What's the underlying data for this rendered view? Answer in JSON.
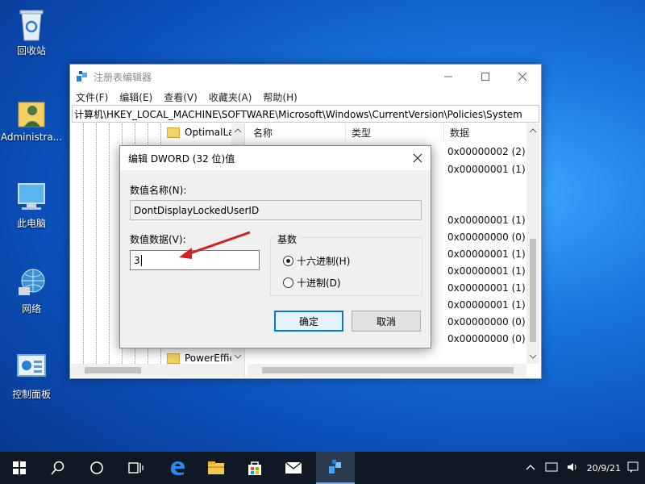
{
  "desktop": {
    "icons": [
      {
        "label": "回收站",
        "icon": "recycle-bin-icon"
      },
      {
        "label": "Administra...",
        "icon": "user-folder-icon"
      },
      {
        "label": "此电脑",
        "icon": "computer-icon"
      },
      {
        "label": "网络",
        "icon": "network-icon"
      },
      {
        "label": "控制面板",
        "icon": "control-panel-icon"
      }
    ]
  },
  "window": {
    "title": "注册表编辑器",
    "menu": [
      "文件(F)",
      "编辑(E)",
      "查看(V)",
      "收藏夹(A)",
      "帮助(H)"
    ],
    "address": "计算机\\HKEY_LOCAL_MACHINE\\SOFTWARE\\Microsoft\\Windows\\CurrentVersion\\Policies\\System",
    "tree": {
      "top_item": "OptimalLa",
      "bottom_item": "PowerEffic"
    },
    "columns": {
      "name": "名称",
      "type": "类型",
      "data": "数据"
    },
    "data_values": [
      "0x00000002 (2)",
      "0x00000001 (1)",
      "0x00000001 (1)",
      "0x00000000 (0)",
      "0x00000001 (1)",
      "0x00000001 (1)",
      "0x00000001 (1)",
      "0x00000001 (1)",
      "0x00000000 (0)",
      "0x00000000 (0)"
    ]
  },
  "dialog": {
    "title": "编辑 DWORD (32 位)值",
    "value_name_label": "数值名称(N):",
    "value_name": "DontDisplayLockedUserID",
    "value_data_label": "数值数据(V):",
    "value_data": "3",
    "base_label": "基数",
    "hex_label": "十六进制(H)",
    "dec_label": "十进制(D)",
    "ok_label": "确定",
    "cancel_label": "取消",
    "selected_base": "hex",
    "annotation_arrow_color": "#d42020"
  },
  "taskbar": {
    "items": [
      "start-icon",
      "search-icon",
      "cortana-icon",
      "task-view-icon",
      "edge-icon",
      "file-explorer-icon",
      "store-icon",
      "mail-icon",
      "regedit-icon"
    ],
    "clock_date": "20/9/21"
  },
  "colors": {
    "accent": "#0078d7",
    "taskbar": "#101823"
  }
}
